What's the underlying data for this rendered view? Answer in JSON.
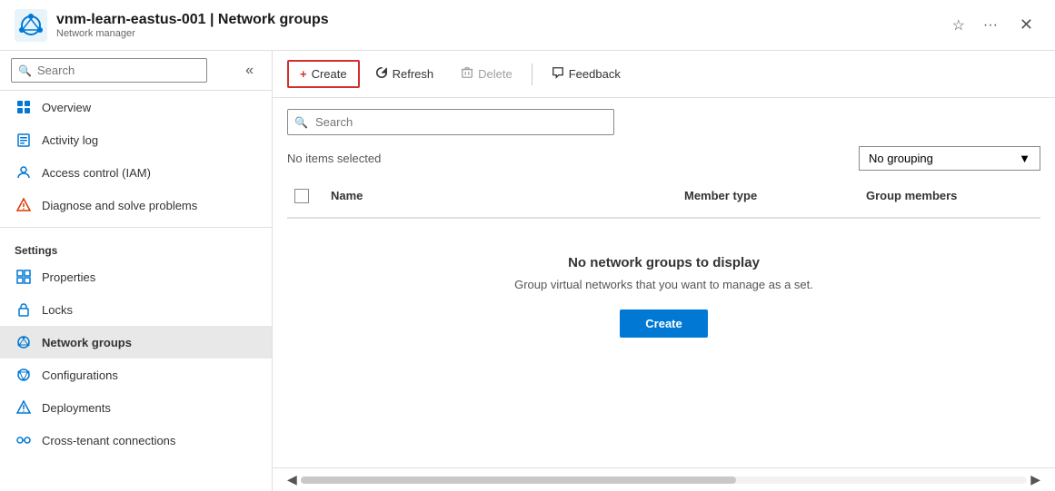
{
  "header": {
    "resource_name": "vnm-learn-eastus-001",
    "separator": "|",
    "page_title": "Network groups",
    "subtitle": "Network manager",
    "favorite_icon": "★",
    "more_icon": "···",
    "close_icon": "✕"
  },
  "sidebar": {
    "search_placeholder": "Search",
    "collapse_icon": "«",
    "nav_items": [
      {
        "id": "overview",
        "label": "Overview",
        "icon": "⊕"
      },
      {
        "id": "activity-log",
        "label": "Activity log",
        "icon": "📋"
      },
      {
        "id": "access-control",
        "label": "Access control (IAM)",
        "icon": "👤"
      },
      {
        "id": "diagnose",
        "label": "Diagnose and solve problems",
        "icon": "🔧"
      }
    ],
    "settings_label": "Settings",
    "settings_items": [
      {
        "id": "properties",
        "label": "Properties",
        "icon": "▦"
      },
      {
        "id": "locks",
        "label": "Locks",
        "icon": "🔒"
      },
      {
        "id": "network-groups",
        "label": "Network groups",
        "icon": "⊕",
        "active": true
      },
      {
        "id": "configurations",
        "label": "Configurations",
        "icon": "⊕"
      },
      {
        "id": "deployments",
        "label": "Deployments",
        "icon": "⬡"
      },
      {
        "id": "cross-tenant",
        "label": "Cross-tenant connections",
        "icon": "⊕"
      }
    ]
  },
  "toolbar": {
    "create_label": "Create",
    "refresh_label": "Refresh",
    "delete_label": "Delete",
    "feedback_label": "Feedback"
  },
  "content": {
    "search_placeholder": "Search",
    "no_items_label": "No items selected",
    "grouping_label": "No grouping",
    "table_headers": {
      "name": "Name",
      "member_type": "Member type",
      "group_members": "Group members"
    },
    "empty_state": {
      "title": "No network groups to display",
      "description": "Group virtual networks that you want to manage as a set.",
      "create_label": "Create"
    }
  }
}
